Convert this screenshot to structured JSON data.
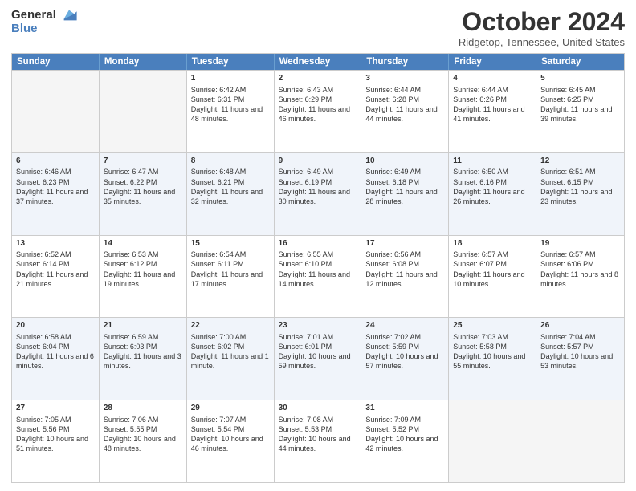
{
  "header": {
    "logo_line1": "General",
    "logo_line2": "Blue",
    "month": "October 2024",
    "location": "Ridgetop, Tennessee, United States"
  },
  "days_of_week": [
    "Sunday",
    "Monday",
    "Tuesday",
    "Wednesday",
    "Thursday",
    "Friday",
    "Saturday"
  ],
  "rows": [
    {
      "alt": false,
      "cells": [
        {
          "day": "",
          "info": ""
        },
        {
          "day": "",
          "info": ""
        },
        {
          "day": "1",
          "info": "Sunrise: 6:42 AM\nSunset: 6:31 PM\nDaylight: 11 hours and 48 minutes."
        },
        {
          "day": "2",
          "info": "Sunrise: 6:43 AM\nSunset: 6:29 PM\nDaylight: 11 hours and 46 minutes."
        },
        {
          "day": "3",
          "info": "Sunrise: 6:44 AM\nSunset: 6:28 PM\nDaylight: 11 hours and 44 minutes."
        },
        {
          "day": "4",
          "info": "Sunrise: 6:44 AM\nSunset: 6:26 PM\nDaylight: 11 hours and 41 minutes."
        },
        {
          "day": "5",
          "info": "Sunrise: 6:45 AM\nSunset: 6:25 PM\nDaylight: 11 hours and 39 minutes."
        }
      ]
    },
    {
      "alt": true,
      "cells": [
        {
          "day": "6",
          "info": "Sunrise: 6:46 AM\nSunset: 6:23 PM\nDaylight: 11 hours and 37 minutes."
        },
        {
          "day": "7",
          "info": "Sunrise: 6:47 AM\nSunset: 6:22 PM\nDaylight: 11 hours and 35 minutes."
        },
        {
          "day": "8",
          "info": "Sunrise: 6:48 AM\nSunset: 6:21 PM\nDaylight: 11 hours and 32 minutes."
        },
        {
          "day": "9",
          "info": "Sunrise: 6:49 AM\nSunset: 6:19 PM\nDaylight: 11 hours and 30 minutes."
        },
        {
          "day": "10",
          "info": "Sunrise: 6:49 AM\nSunset: 6:18 PM\nDaylight: 11 hours and 28 minutes."
        },
        {
          "day": "11",
          "info": "Sunrise: 6:50 AM\nSunset: 6:16 PM\nDaylight: 11 hours and 26 minutes."
        },
        {
          "day": "12",
          "info": "Sunrise: 6:51 AM\nSunset: 6:15 PM\nDaylight: 11 hours and 23 minutes."
        }
      ]
    },
    {
      "alt": false,
      "cells": [
        {
          "day": "13",
          "info": "Sunrise: 6:52 AM\nSunset: 6:14 PM\nDaylight: 11 hours and 21 minutes."
        },
        {
          "day": "14",
          "info": "Sunrise: 6:53 AM\nSunset: 6:12 PM\nDaylight: 11 hours and 19 minutes."
        },
        {
          "day": "15",
          "info": "Sunrise: 6:54 AM\nSunset: 6:11 PM\nDaylight: 11 hours and 17 minutes."
        },
        {
          "day": "16",
          "info": "Sunrise: 6:55 AM\nSunset: 6:10 PM\nDaylight: 11 hours and 14 minutes."
        },
        {
          "day": "17",
          "info": "Sunrise: 6:56 AM\nSunset: 6:08 PM\nDaylight: 11 hours and 12 minutes."
        },
        {
          "day": "18",
          "info": "Sunrise: 6:57 AM\nSunset: 6:07 PM\nDaylight: 11 hours and 10 minutes."
        },
        {
          "day": "19",
          "info": "Sunrise: 6:57 AM\nSunset: 6:06 PM\nDaylight: 11 hours and 8 minutes."
        }
      ]
    },
    {
      "alt": true,
      "cells": [
        {
          "day": "20",
          "info": "Sunrise: 6:58 AM\nSunset: 6:04 PM\nDaylight: 11 hours and 6 minutes."
        },
        {
          "day": "21",
          "info": "Sunrise: 6:59 AM\nSunset: 6:03 PM\nDaylight: 11 hours and 3 minutes."
        },
        {
          "day": "22",
          "info": "Sunrise: 7:00 AM\nSunset: 6:02 PM\nDaylight: 11 hours and 1 minute."
        },
        {
          "day": "23",
          "info": "Sunrise: 7:01 AM\nSunset: 6:01 PM\nDaylight: 10 hours and 59 minutes."
        },
        {
          "day": "24",
          "info": "Sunrise: 7:02 AM\nSunset: 5:59 PM\nDaylight: 10 hours and 57 minutes."
        },
        {
          "day": "25",
          "info": "Sunrise: 7:03 AM\nSunset: 5:58 PM\nDaylight: 10 hours and 55 minutes."
        },
        {
          "day": "26",
          "info": "Sunrise: 7:04 AM\nSunset: 5:57 PM\nDaylight: 10 hours and 53 minutes."
        }
      ]
    },
    {
      "alt": false,
      "cells": [
        {
          "day": "27",
          "info": "Sunrise: 7:05 AM\nSunset: 5:56 PM\nDaylight: 10 hours and 51 minutes."
        },
        {
          "day": "28",
          "info": "Sunrise: 7:06 AM\nSunset: 5:55 PM\nDaylight: 10 hours and 48 minutes."
        },
        {
          "day": "29",
          "info": "Sunrise: 7:07 AM\nSunset: 5:54 PM\nDaylight: 10 hours and 46 minutes."
        },
        {
          "day": "30",
          "info": "Sunrise: 7:08 AM\nSunset: 5:53 PM\nDaylight: 10 hours and 44 minutes."
        },
        {
          "day": "31",
          "info": "Sunrise: 7:09 AM\nSunset: 5:52 PM\nDaylight: 10 hours and 42 minutes."
        },
        {
          "day": "",
          "info": ""
        },
        {
          "day": "",
          "info": ""
        }
      ]
    }
  ]
}
